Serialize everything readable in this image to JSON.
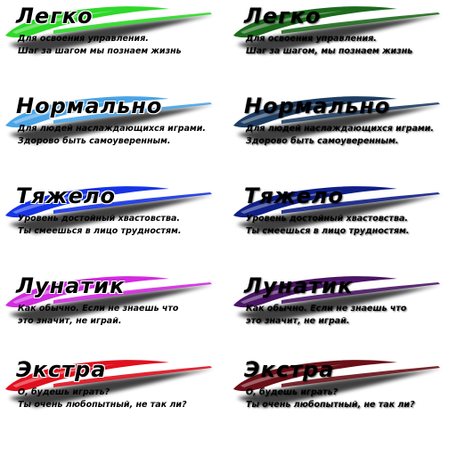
{
  "tiles": [
    {
      "title": "Легко",
      "line1": "Для освоения управления.",
      "line2": "Шаг за шагом мы познаем жизнь",
      "color": "#2fd82a"
    },
    {
      "title": "Легко",
      "line1": "Для освоения управления.",
      "line2": "Шаг за шагом, мы познаем жизнь",
      "color": "#1d6a1d"
    },
    {
      "title": "Нормально",
      "line1": "Для людей наслаждающихся играми.",
      "line2": "Здорово быть самоуверенным.",
      "color": "#4aa4e6"
    },
    {
      "title": "Нормально",
      "line1": "Для людей наслаждающихся играми.",
      "line2": "Здорово быть самоуверенным.",
      "color": "#1e3d62"
    },
    {
      "title": "Тяжело",
      "line1": "Уровень достойный хвастовства.",
      "line2": "Ты смеешься в лицо трудностям.",
      "color": "#1634e6"
    },
    {
      "title": "Тяжело",
      "line1": "Уровень достойный хвастовства.",
      "line2": "Ты смеешься в лицо трудностям.",
      "color": "#0f1f86"
    },
    {
      "title": "Лунатик",
      "line1": "Как обычно. Если не знаешь что",
      "line2": "это значит, не играй.",
      "color": "#d22be0"
    },
    {
      "title": "Лунатик",
      "line1": "Как обычно. Если не знаешь что",
      "line2": "это значит, не играй.",
      "color": "#4a1565"
    },
    {
      "title": "Экстра",
      "line1": "О, будешь играть?",
      "line2": "Ты очень любопытный, не так ли?",
      "color": "#e0101e"
    },
    {
      "title": "Экстра",
      "line1": "О, будешь играть?",
      "line2": "Ты очень любопытный, не так ли?",
      "color": "#6a0f17"
    }
  ]
}
